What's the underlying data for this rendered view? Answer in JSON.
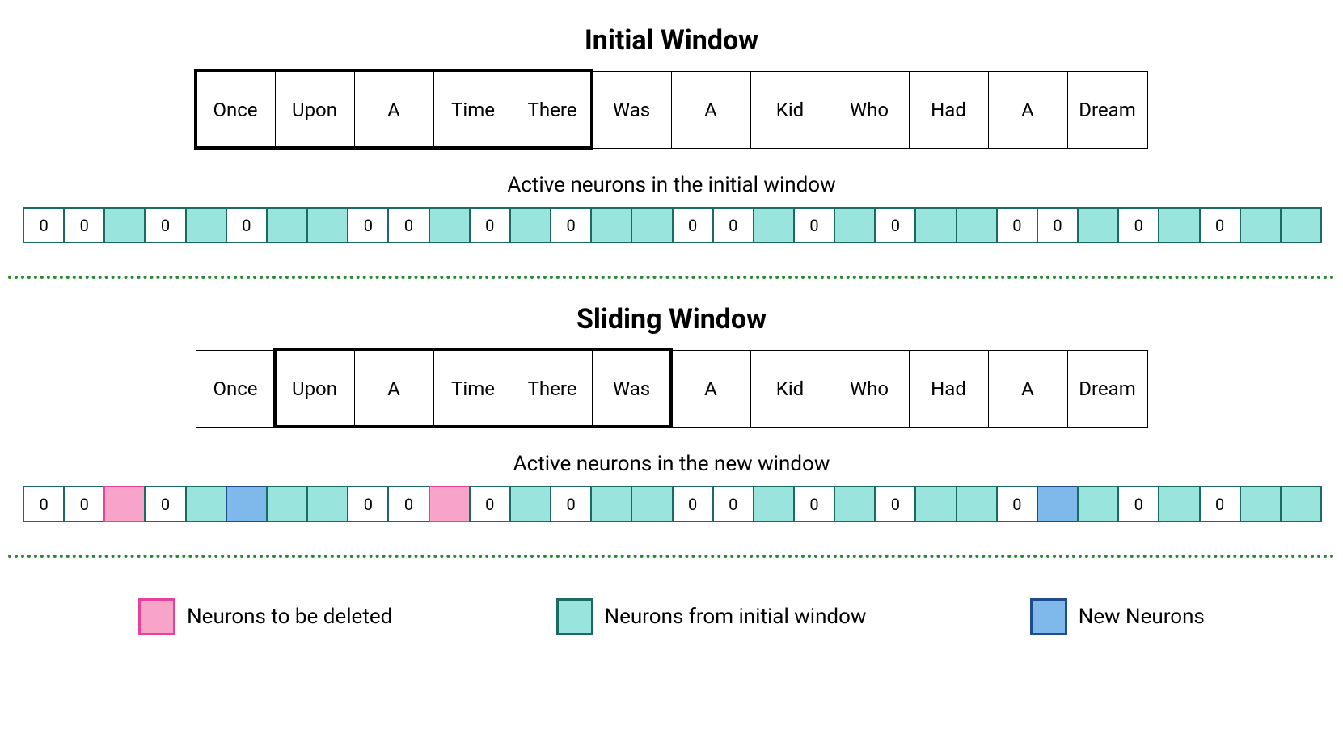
{
  "titles": {
    "initial": "Initial Window",
    "sliding": "Sliding Window",
    "neurons_initial": "Active neurons in the initial window",
    "neurons_new": "Active neurons in the new window"
  },
  "words": [
    "Once",
    "Upon",
    "A",
    "Time",
    "There",
    "Was",
    "A",
    "Kid",
    "Who",
    "Had",
    "A",
    "Dream"
  ],
  "windows": {
    "initial": {
      "start": 0,
      "end": 5
    },
    "sliding": {
      "start": 1,
      "end": 6
    }
  },
  "neurons_initial": [
    {
      "v": "0",
      "t": "z"
    },
    {
      "v": "0",
      "t": "z"
    },
    {
      "v": "",
      "t": "a"
    },
    {
      "v": "0",
      "t": "z"
    },
    {
      "v": "",
      "t": "a"
    },
    {
      "v": "0",
      "t": "z"
    },
    {
      "v": "",
      "t": "a"
    },
    {
      "v": "",
      "t": "a"
    },
    {
      "v": "0",
      "t": "z"
    },
    {
      "v": "0",
      "t": "z"
    },
    {
      "v": "",
      "t": "a"
    },
    {
      "v": "0",
      "t": "z"
    },
    {
      "v": "",
      "t": "a"
    },
    {
      "v": "0",
      "t": "z"
    },
    {
      "v": "",
      "t": "a"
    },
    {
      "v": "",
      "t": "a"
    },
    {
      "v": "0",
      "t": "z"
    },
    {
      "v": "0",
      "t": "z"
    },
    {
      "v": "",
      "t": "a"
    },
    {
      "v": "0",
      "t": "z"
    },
    {
      "v": "",
      "t": "a"
    },
    {
      "v": "0",
      "t": "z"
    },
    {
      "v": "",
      "t": "a"
    },
    {
      "v": "",
      "t": "a"
    },
    {
      "v": "0",
      "t": "z"
    },
    {
      "v": "0",
      "t": "z"
    },
    {
      "v": "",
      "t": "a"
    },
    {
      "v": "0",
      "t": "z"
    },
    {
      "v": "",
      "t": "a"
    },
    {
      "v": "0",
      "t": "z"
    },
    {
      "v": "",
      "t": "a"
    },
    {
      "v": "",
      "t": "a"
    }
  ],
  "neurons_new": [
    {
      "v": "0",
      "t": "z"
    },
    {
      "v": "0",
      "t": "z"
    },
    {
      "v": "",
      "t": "d"
    },
    {
      "v": "0",
      "t": "z"
    },
    {
      "v": "",
      "t": "a"
    },
    {
      "v": "",
      "t": "n"
    },
    {
      "v": "",
      "t": "a"
    },
    {
      "v": "",
      "t": "a"
    },
    {
      "v": "0",
      "t": "z"
    },
    {
      "v": "0",
      "t": "z"
    },
    {
      "v": "",
      "t": "d"
    },
    {
      "v": "0",
      "t": "z"
    },
    {
      "v": "",
      "t": "a"
    },
    {
      "v": "0",
      "t": "z"
    },
    {
      "v": "",
      "t": "a"
    },
    {
      "v": "",
      "t": "a"
    },
    {
      "v": "0",
      "t": "z"
    },
    {
      "v": "0",
      "t": "z"
    },
    {
      "v": "",
      "t": "a"
    },
    {
      "v": "0",
      "t": "z"
    },
    {
      "v": "",
      "t": "a"
    },
    {
      "v": "0",
      "t": "z"
    },
    {
      "v": "",
      "t": "a"
    },
    {
      "v": "",
      "t": "a"
    },
    {
      "v": "0",
      "t": "z"
    },
    {
      "v": "",
      "t": "n"
    },
    {
      "v": "",
      "t": "a"
    },
    {
      "v": "0",
      "t": "z"
    },
    {
      "v": "",
      "t": "a"
    },
    {
      "v": "0",
      "t": "z"
    },
    {
      "v": "",
      "t": "a"
    },
    {
      "v": "",
      "t": "a"
    }
  ],
  "legend": {
    "deleted": "Neurons to be deleted",
    "initial": "Neurons from initial window",
    "new_": "New Neurons"
  }
}
